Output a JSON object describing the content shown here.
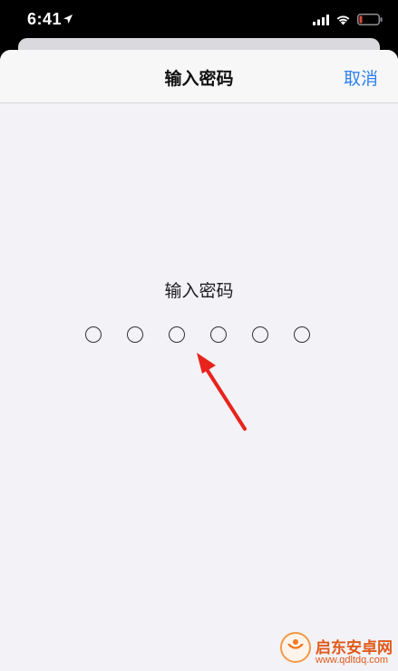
{
  "status_bar": {
    "time": "6:41",
    "icons": [
      "location-arrow-icon",
      "cellular-signal-icon",
      "wifi-icon",
      "battery-low-icon"
    ],
    "battery_color": "#e0463c"
  },
  "nav": {
    "title": "输入密码",
    "cancel_label": "取消"
  },
  "passcode": {
    "prompt": "输入密码",
    "digits_total": 6,
    "digits_entered": 0
  },
  "annotation": {
    "icon": "red-arrow-icon",
    "color": "#e8231c"
  },
  "watermark": {
    "title": "启东安卓网",
    "url": "www.qdltdq.com"
  },
  "colors": {
    "accent": "#2f80ed",
    "sheet_background": "#f2f2f7"
  }
}
